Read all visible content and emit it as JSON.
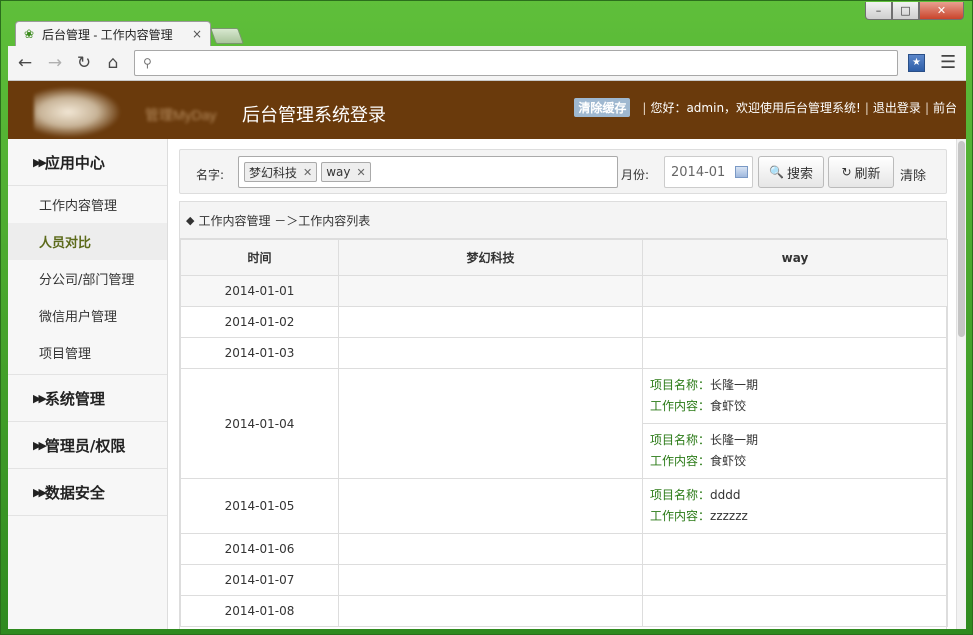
{
  "browser": {
    "tab_title": "后台管理 - 工作内容管理",
    "tab_close": "×",
    "address_value": "",
    "window_min": "–",
    "window_max": "□",
    "window_close": "✕"
  },
  "header": {
    "logo_sub": "管理MyDay",
    "title": "后台管理系统登录",
    "clear_cache": "清除缓存",
    "greeting": "您好：admin，欢迎使用后台管理系统!",
    "logout": "退出登录",
    "frontend": "前台"
  },
  "sidebar": {
    "groups": [
      {
        "label": "应用中心"
      },
      {
        "label": "系统管理"
      },
      {
        "label": "管理员/权限"
      },
      {
        "label": "数据安全"
      }
    ],
    "items": [
      {
        "label": "工作内容管理"
      },
      {
        "label": "人员对比"
      },
      {
        "label": "分公司/部门管理"
      },
      {
        "label": "微信用户管理"
      },
      {
        "label": "项目管理"
      }
    ]
  },
  "filter": {
    "name_label": "名字:",
    "tags": [
      "梦幻科技",
      "way"
    ],
    "month_label": "月份:",
    "month_value": "2014-01",
    "search_label": "搜索",
    "refresh_label": "刷新",
    "clear_label": "清除"
  },
  "panel": {
    "breadcrumb": "工作内容管理 －＞工作内容列表",
    "columns": [
      "时间",
      "梦幻科技",
      "way"
    ],
    "rows": [
      {
        "date": "2014-01-01"
      },
      {
        "date": "2014-01-02"
      },
      {
        "date": "2014-01-03"
      },
      {
        "date": "2014-01-04",
        "way": [
          {
            "project_key": "项目名称：",
            "project": "长隆一期",
            "content_key": "工作内容：",
            "content": "食虾饺"
          },
          {
            "project_key": "项目名称：",
            "project": "长隆一期",
            "content_key": "工作内容：",
            "content": "食虾饺"
          }
        ]
      },
      {
        "date": "2014-01-05",
        "way": [
          {
            "project_key": "项目名称：",
            "project": "dddd",
            "content_key": "工作内容：",
            "content": "zzzzzz"
          }
        ]
      },
      {
        "date": "2014-01-06"
      },
      {
        "date": "2014-01-07"
      },
      {
        "date": "2014-01-08"
      }
    ]
  },
  "colors": {
    "header_bg": "#6a3a0c",
    "accent_green": "#2a7a16",
    "window_frame": "#3c9a2a"
  }
}
